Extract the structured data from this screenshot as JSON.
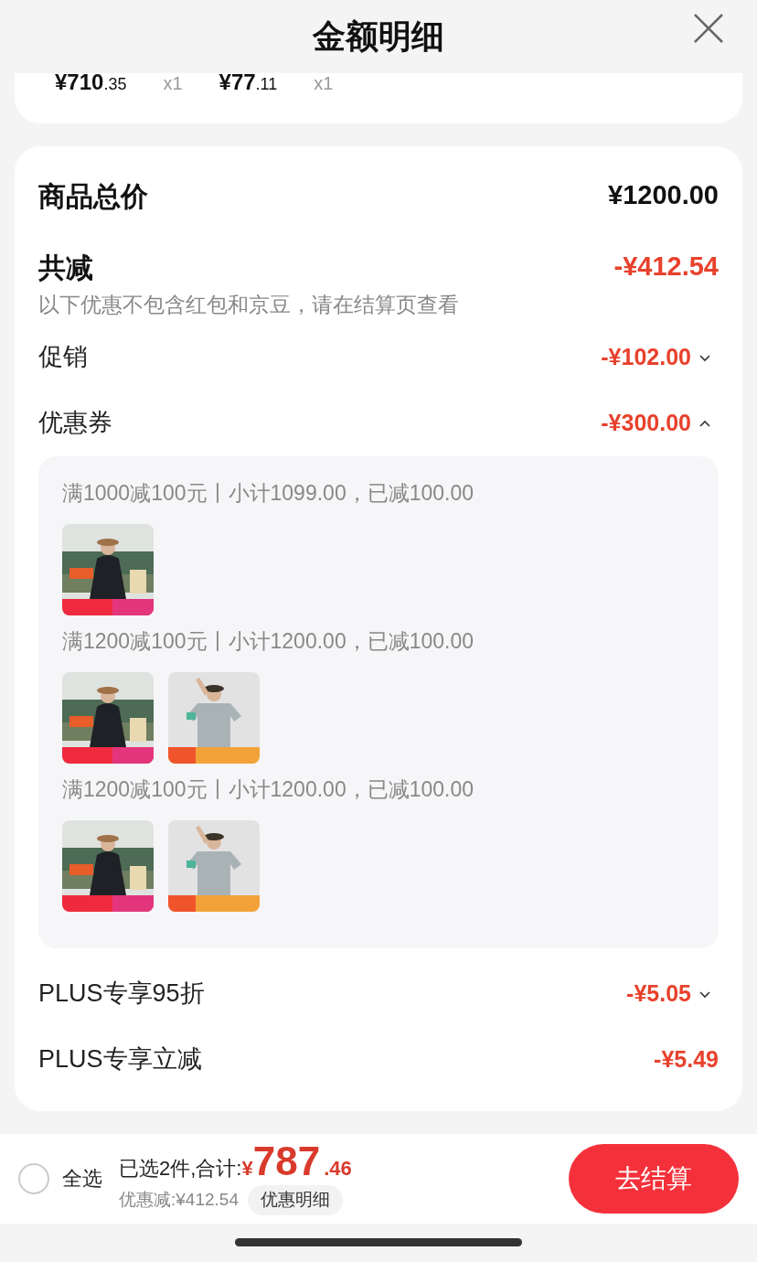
{
  "header": {
    "title": "金额明细"
  },
  "top_items": [
    {
      "price_main": "¥710",
      "price_decimal": ".35",
      "quantity": "x1"
    },
    {
      "price_main": "¥77",
      "price_decimal": ".11",
      "quantity": "x1"
    }
  ],
  "total": {
    "label": "商品总价",
    "value": "¥1200.00"
  },
  "reduction": {
    "label": "共减",
    "value": "-¥412.54",
    "note": "以下优惠不包含红包和京豆，请在结算页查看"
  },
  "discounts": [
    {
      "label": "促销",
      "value": "-¥102.00",
      "kind": "expandable",
      "expanded": false
    },
    {
      "label": "优惠券",
      "value": "-¥300.00",
      "kind": "expandable",
      "expanded": true,
      "groups": [
        {
          "text": "满1000减100元丨小计1099.00，已减100.00",
          "products": [
            {
              "kind": "jacket"
            }
          ]
        },
        {
          "text": "满1200减100元丨小计1200.00，已减100.00",
          "products": [
            {
              "kind": "jacket"
            },
            {
              "kind": "tshirt"
            }
          ]
        },
        {
          "text": "满1200减100元丨小计1200.00，已减100.00",
          "products": [
            {
              "kind": "jacket"
            },
            {
              "kind": "tshirt"
            }
          ]
        }
      ]
    },
    {
      "label": "PLUS专享95折",
      "value": "-¥5.05",
      "kind": "expandable",
      "expanded": false
    },
    {
      "label": "PLUS专享立减",
      "value": "-¥5.49",
      "kind": "plain"
    }
  ],
  "bottom_bar": {
    "select_all": {
      "label": "全选",
      "checked": false
    },
    "selected_text": "已选2件,合计:",
    "currency": "¥",
    "amount_main": "787",
    "amount_decimal": ".46",
    "discount_text": "优惠减:¥412.54",
    "detail_button": "优惠明细",
    "checkout_button": "去结算"
  }
}
